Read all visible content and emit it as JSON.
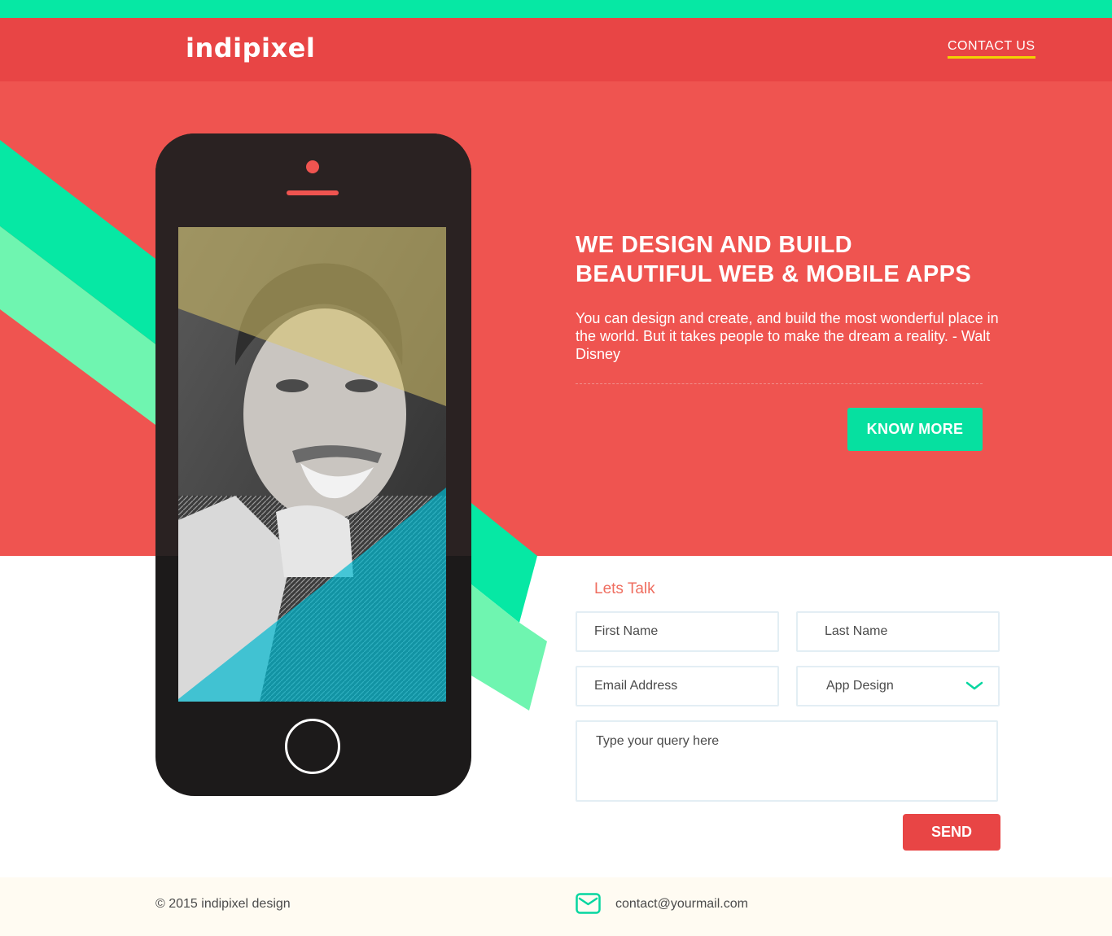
{
  "brand": {
    "name": "indipixel",
    "nav_contact": "CONTACT US"
  },
  "hero": {
    "headline_line1": "WE DESIGN AND BUILD",
    "headline_line2": "BEAUTIFUL WEB & MOBILE APPS",
    "quote": "You can design and create, and build the most wonderful place in the world. But it takes people to make the dream a reality. - Walt Disney",
    "cta_label": "KNOW MORE",
    "phone_image_icon": "portrait-photo"
  },
  "form": {
    "title": "Lets Talk",
    "first_name_placeholder": "First Name",
    "last_name_placeholder": "Last  Name",
    "email_placeholder": "Email Address",
    "service_selected": "App Design",
    "query_placeholder": "Type your query here",
    "send_label": "SEND"
  },
  "footer": {
    "copyright": "© 2015 indipixel design",
    "email": "contact@yourmail.com",
    "email_icon": "mail-icon"
  },
  "colors": {
    "topbar": "#06e8a4",
    "header": "#e84545",
    "hero": "#ef5450",
    "accent_green": "#06e0a0",
    "underline_yellow": "#f2d200",
    "footer_bg": "#fffbf2"
  }
}
